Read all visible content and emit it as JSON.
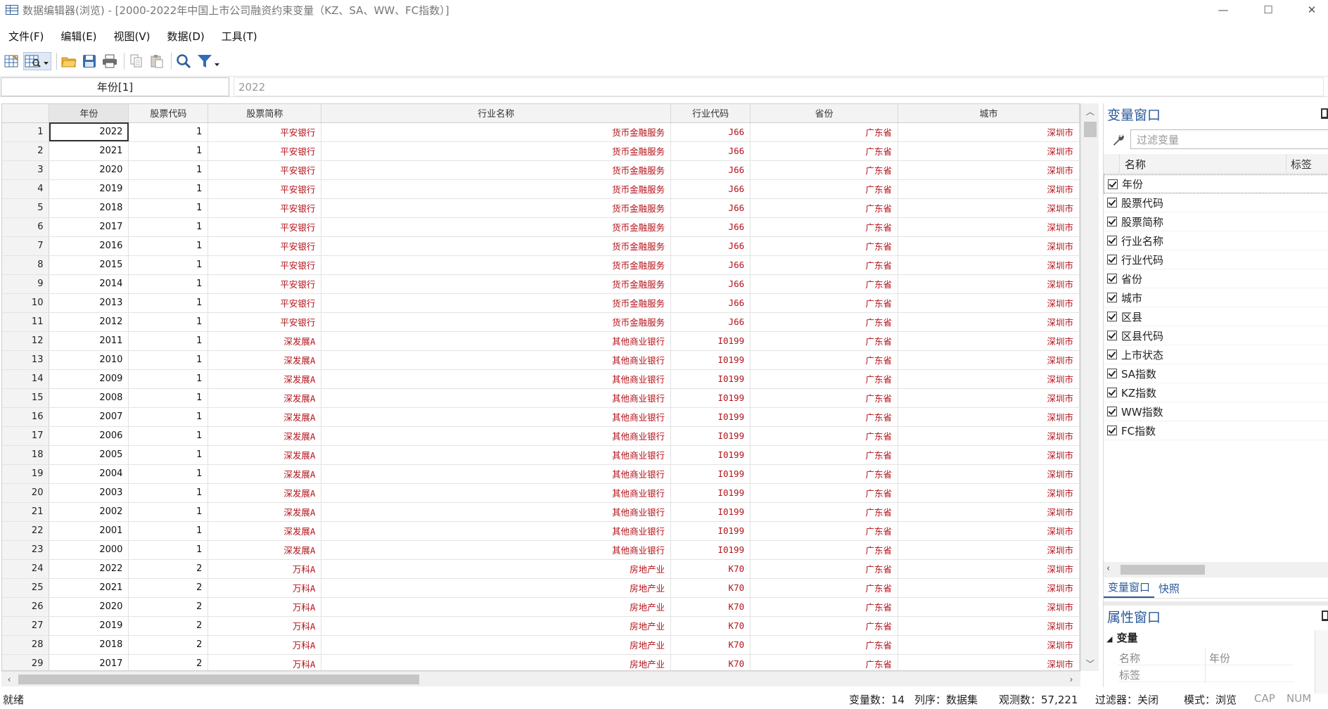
{
  "window": {
    "title": "数据编辑器(浏览) - [2000-2022年中国上市公司融资约束变量（KZ、SA、WW、FC指数）]",
    "minimize_glyph": "—",
    "maximize_glyph": "☐",
    "close_glyph": "✕"
  },
  "menu": [
    "文件(F)",
    "编辑(E)",
    "视图(V)",
    "数据(D)",
    "工具(T)"
  ],
  "toolbar_icons": [
    "grid-edit-icon",
    "grid-browse-icon",
    "open-folder-icon",
    "save-icon",
    "print-icon",
    "copy-icon",
    "paste-icon",
    "search-icon",
    "filter-icon"
  ],
  "editbar": {
    "cell_ref": "年份[1]",
    "cell_value": "2022"
  },
  "grid": {
    "columns": [
      "年份",
      "股票代码",
      "股票简称",
      "行业名称",
      "行业代码",
      "省份",
      "城市"
    ],
    "rows": [
      [
        "2022",
        "1",
        "平安银行",
        "货币金融服务",
        "J66",
        "广东省",
        "深圳市"
      ],
      [
        "2021",
        "1",
        "平安银行",
        "货币金融服务",
        "J66",
        "广东省",
        "深圳市"
      ],
      [
        "2020",
        "1",
        "平安银行",
        "货币金融服务",
        "J66",
        "广东省",
        "深圳市"
      ],
      [
        "2019",
        "1",
        "平安银行",
        "货币金融服务",
        "J66",
        "广东省",
        "深圳市"
      ],
      [
        "2018",
        "1",
        "平安银行",
        "货币金融服务",
        "J66",
        "广东省",
        "深圳市"
      ],
      [
        "2017",
        "1",
        "平安银行",
        "货币金融服务",
        "J66",
        "广东省",
        "深圳市"
      ],
      [
        "2016",
        "1",
        "平安银行",
        "货币金融服务",
        "J66",
        "广东省",
        "深圳市"
      ],
      [
        "2015",
        "1",
        "平安银行",
        "货币金融服务",
        "J66",
        "广东省",
        "深圳市"
      ],
      [
        "2014",
        "1",
        "平安银行",
        "货币金融服务",
        "J66",
        "广东省",
        "深圳市"
      ],
      [
        "2013",
        "1",
        "平安银行",
        "货币金融服务",
        "J66",
        "广东省",
        "深圳市"
      ],
      [
        "2012",
        "1",
        "平安银行",
        "货币金融服务",
        "J66",
        "广东省",
        "深圳市"
      ],
      [
        "2011",
        "1",
        "深发展A",
        "其他商业银行",
        "I0199",
        "广东省",
        "深圳市"
      ],
      [
        "2010",
        "1",
        "深发展A",
        "其他商业银行",
        "I0199",
        "广东省",
        "深圳市"
      ],
      [
        "2009",
        "1",
        "深发展A",
        "其他商业银行",
        "I0199",
        "广东省",
        "深圳市"
      ],
      [
        "2008",
        "1",
        "深发展A",
        "其他商业银行",
        "I0199",
        "广东省",
        "深圳市"
      ],
      [
        "2007",
        "1",
        "深发展A",
        "其他商业银行",
        "I0199",
        "广东省",
        "深圳市"
      ],
      [
        "2006",
        "1",
        "深发展A",
        "其他商业银行",
        "I0199",
        "广东省",
        "深圳市"
      ],
      [
        "2005",
        "1",
        "深发展A",
        "其他商业银行",
        "I0199",
        "广东省",
        "深圳市"
      ],
      [
        "2004",
        "1",
        "深发展A",
        "其他商业银行",
        "I0199",
        "广东省",
        "深圳市"
      ],
      [
        "2003",
        "1",
        "深发展A",
        "其他商业银行",
        "I0199",
        "广东省",
        "深圳市"
      ],
      [
        "2002",
        "1",
        "深发展A",
        "其他商业银行",
        "I0199",
        "广东省",
        "深圳市"
      ],
      [
        "2001",
        "1",
        "深发展A",
        "其他商业银行",
        "I0199",
        "广东省",
        "深圳市"
      ],
      [
        "2000",
        "1",
        "深发展A",
        "其他商业银行",
        "I0199",
        "广东省",
        "深圳市"
      ],
      [
        "2022",
        "2",
        "万科A",
        "房地产业",
        "K70",
        "广东省",
        "深圳市"
      ],
      [
        "2021",
        "2",
        "万科A",
        "房地产业",
        "K70",
        "广东省",
        "深圳市"
      ],
      [
        "2020",
        "2",
        "万科A",
        "房地产业",
        "K70",
        "广东省",
        "深圳市"
      ],
      [
        "2019",
        "2",
        "万科A",
        "房地产业",
        "K70",
        "广东省",
        "深圳市"
      ],
      [
        "2018",
        "2",
        "万科A",
        "房地产业",
        "K70",
        "广东省",
        "深圳市"
      ],
      [
        "2017",
        "2",
        "万科A",
        "房地产业",
        "K70",
        "广东省",
        "深圳市"
      ]
    ]
  },
  "variables_panel": {
    "title": "变量窗口",
    "filter_placeholder": "过滤变量",
    "col_name": "名称",
    "col_label": "标签",
    "variables": [
      "年份",
      "股票代码",
      "股票简称",
      "行业名称",
      "行业代码",
      "省份",
      "城市",
      "区县",
      "区县代码",
      "上市状态",
      "SA指数",
      "KZ指数",
      "WW指数",
      "FC指数"
    ],
    "tabs": [
      "变量窗口",
      "快照"
    ]
  },
  "properties_panel": {
    "title": "属性窗口",
    "section": "变量",
    "rows": [
      {
        "key": "名称",
        "value": "年份"
      },
      {
        "key": "标签",
        "value": ""
      }
    ]
  },
  "status": {
    "left": "就绪",
    "var_count": "变量数：14",
    "sort": "列序：数据集",
    "obs": "观测数：57,221",
    "filter": "过滤器：关闭",
    "mode": "模式：浏览",
    "cap": "CAP",
    "num": "NUM"
  },
  "colors": {
    "string_text": "#b3121a",
    "panel_accent": "#2a5a9a"
  }
}
